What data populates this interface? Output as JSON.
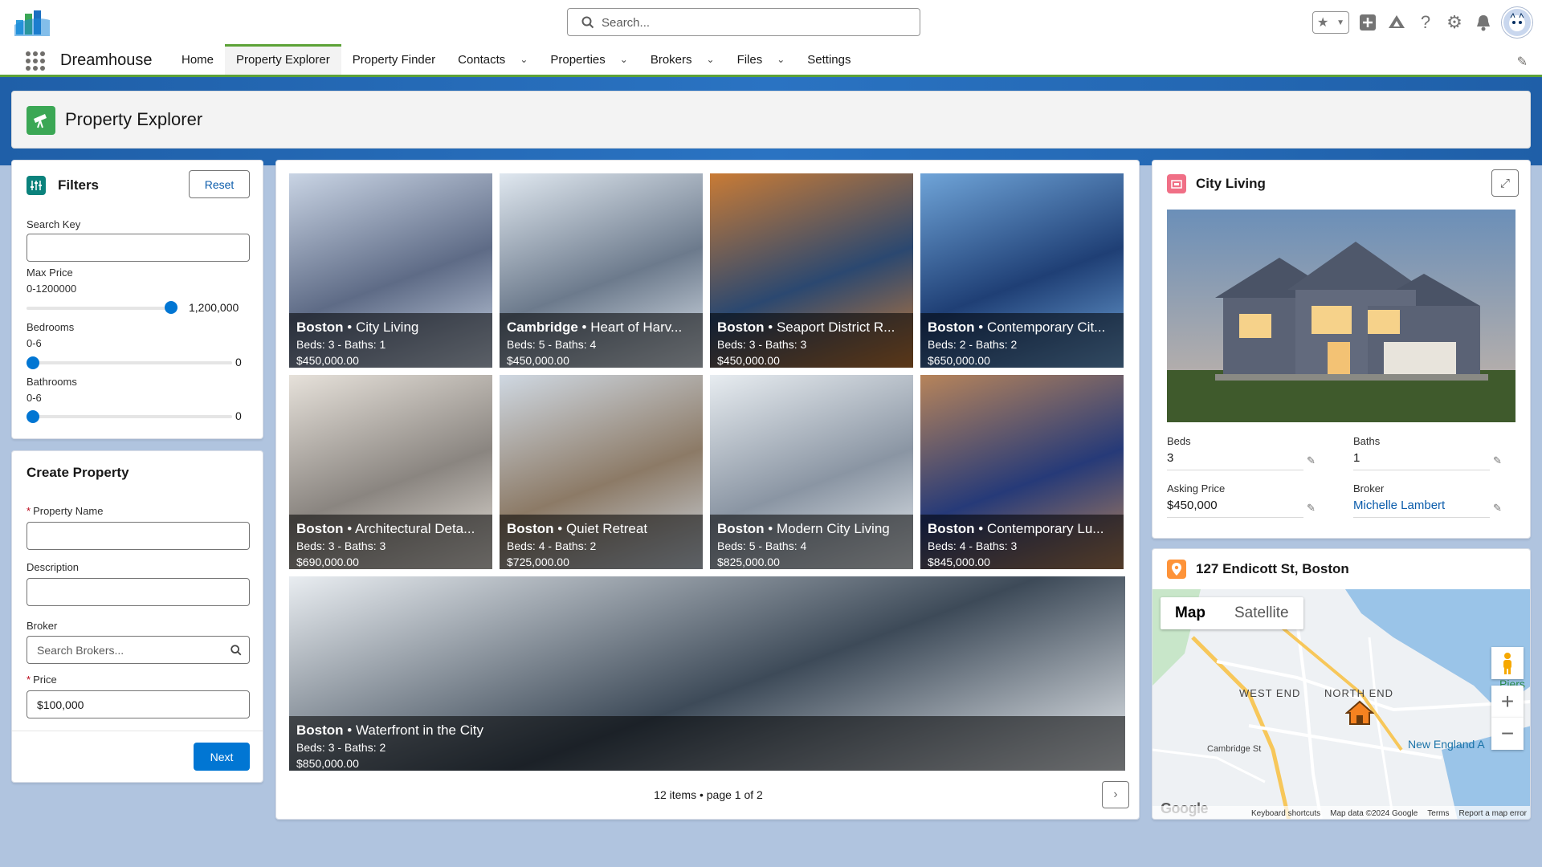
{
  "header": {
    "search_placeholder": "Search...",
    "app_name": "Dreamhouse"
  },
  "nav": {
    "items": [
      {
        "label": "Home",
        "dropdown": false,
        "active": false
      },
      {
        "label": "Property Explorer",
        "dropdown": false,
        "active": true
      },
      {
        "label": "Property Finder",
        "dropdown": false,
        "active": false
      },
      {
        "label": "Contacts",
        "dropdown": true,
        "active": false
      },
      {
        "label": "Properties",
        "dropdown": true,
        "active": false
      },
      {
        "label": "Brokers",
        "dropdown": true,
        "active": false
      },
      {
        "label": "Files",
        "dropdown": true,
        "active": false
      },
      {
        "label": "Settings",
        "dropdown": false,
        "active": false
      }
    ]
  },
  "page": {
    "title": "Property Explorer"
  },
  "filters": {
    "title": "Filters",
    "reset_label": "Reset",
    "search_key_label": "Search Key",
    "search_key_value": "",
    "max_price_label": "Max Price",
    "max_price_range": "0-1200000",
    "max_price_value": "1,200,000",
    "max_price_fraction": 1.0,
    "bedrooms_label": "Bedrooms",
    "bedrooms_range": "0-6",
    "bedrooms_value": "0",
    "bedrooms_fraction": 0.0,
    "bathrooms_label": "Bathrooms",
    "bathrooms_range": "0-6",
    "bathrooms_value": "0",
    "bathrooms_fraction": 0.0
  },
  "create": {
    "title": "Create Property",
    "name_label": "Property Name",
    "description_label": "Description",
    "broker_label": "Broker",
    "broker_placeholder": "Search Brokers...",
    "price_label": "Price",
    "price_value": "$100,000",
    "next_label": "Next"
  },
  "tiles": [
    {
      "city": "Boston",
      "name": "City Living",
      "specs": "Beds: 3 - Baths: 1",
      "price": "$450,000.00"
    },
    {
      "city": "Cambridge",
      "name": "Heart of Harv...",
      "specs": "Beds: 5 - Baths: 4",
      "price": "$450,000.00"
    },
    {
      "city": "Boston",
      "name": "Seaport District R...",
      "specs": "Beds: 3 - Baths: 3",
      "price": "$450,000.00"
    },
    {
      "city": "Boston",
      "name": "Contemporary Cit...",
      "specs": "Beds: 2 - Baths: 2",
      "price": "$650,000.00"
    },
    {
      "city": "Boston",
      "name": "Architectural Deta...",
      "specs": "Beds: 3 - Baths: 3",
      "price": "$690,000.00"
    },
    {
      "city": "Boston",
      "name": "Quiet Retreat",
      "specs": "Beds: 4 - Baths: 2",
      "price": "$725,000.00"
    },
    {
      "city": "Boston",
      "name": "Modern City Living",
      "specs": "Beds: 5 - Baths: 4",
      "price": "$825,000.00"
    },
    {
      "city": "Boston",
      "name": "Contemporary Lu...",
      "specs": "Beds: 4 - Baths: 3",
      "price": "$845,000.00"
    },
    {
      "city": "Boston",
      "name": "Waterfront in the City",
      "specs": "Beds: 3 - Baths: 2",
      "price": "$850,000.00"
    }
  ],
  "pager": {
    "text": "12 items • page 1 of 2"
  },
  "detail": {
    "title": "City Living",
    "beds_label": "Beds",
    "beds_value": "3",
    "baths_label": "Baths",
    "baths_value": "1",
    "price_label": "Asking Price",
    "price_value": "$450,000",
    "broker_label": "Broker",
    "broker_value": "Michelle Lambert"
  },
  "map": {
    "title": "127 Endicott St, Boston",
    "tab_map": "Map",
    "tab_satellite": "Satellite",
    "label_west_end": "WEST END",
    "label_north_end": "NORTH END",
    "label_cambridge_st": "Cambridge St",
    "label_new_england": "New England A",
    "label_piers": "Piers F",
    "google": "Google",
    "footer_shortcuts": "Keyboard shortcuts",
    "footer_data": "Map data ©2024 Google",
    "footer_terms": "Terms",
    "footer_report": "Report a map error"
  }
}
